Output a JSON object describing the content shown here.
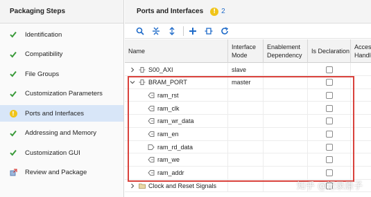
{
  "left_panel": {
    "title": "Packaging Steps",
    "steps": [
      {
        "label": "Identification",
        "status": "done"
      },
      {
        "label": "Compatibility",
        "status": "done"
      },
      {
        "label": "File Groups",
        "status": "done"
      },
      {
        "label": "Customization Parameters",
        "status": "done"
      },
      {
        "label": "Ports and Interfaces",
        "status": "warning",
        "selected": true
      },
      {
        "label": "Addressing and Memory",
        "status": "done"
      },
      {
        "label": "Customization GUI",
        "status": "done"
      },
      {
        "label": "Review and Package",
        "status": "review"
      }
    ]
  },
  "right_panel": {
    "title": "Ports and Interfaces",
    "warning_count": "2",
    "toolbar": [
      "search-icon",
      "collapse-all-icon",
      "expand-all-icon",
      "add-icon",
      "bus-interface-icon",
      "refresh-icon"
    ],
    "columns": {
      "name": "Name",
      "mode": "Interface Mode",
      "enable": "Enablement Dependency",
      "decl": "Is Declaration",
      "access": "Access Handle"
    },
    "rows": [
      {
        "name": "S00_AXI",
        "mode": "slave",
        "level": 0,
        "type": "interface",
        "expanded": false
      },
      {
        "name": "BRAM_PORT",
        "mode": "master",
        "level": 0,
        "type": "interface",
        "expanded": true
      },
      {
        "name": "ram_rst",
        "mode": "",
        "level": 1,
        "type": "port-in"
      },
      {
        "name": "ram_clk",
        "mode": "",
        "level": 1,
        "type": "port-in"
      },
      {
        "name": "ram_wr_data",
        "mode": "",
        "level": 1,
        "type": "port-in"
      },
      {
        "name": "ram_en",
        "mode": "",
        "level": 1,
        "type": "port-in"
      },
      {
        "name": "ram_rd_data",
        "mode": "",
        "level": 1,
        "type": "port-out"
      },
      {
        "name": "ram_we",
        "mode": "",
        "level": 1,
        "type": "port-in"
      },
      {
        "name": "ram_addr",
        "mode": "",
        "level": 1,
        "type": "port-in"
      },
      {
        "name": "Clock and Reset Signals",
        "mode": "",
        "level": 0,
        "type": "folder",
        "expanded": false
      }
    ]
  },
  "watermark": "知乎 @记录原子",
  "colors": {
    "selected_bg": "#d8e6f8",
    "check_green": "#3a9a3a",
    "warning_yellow": "#f0c419",
    "highlight_red": "#d9413b",
    "accent_blue": "#1f6bc9"
  }
}
